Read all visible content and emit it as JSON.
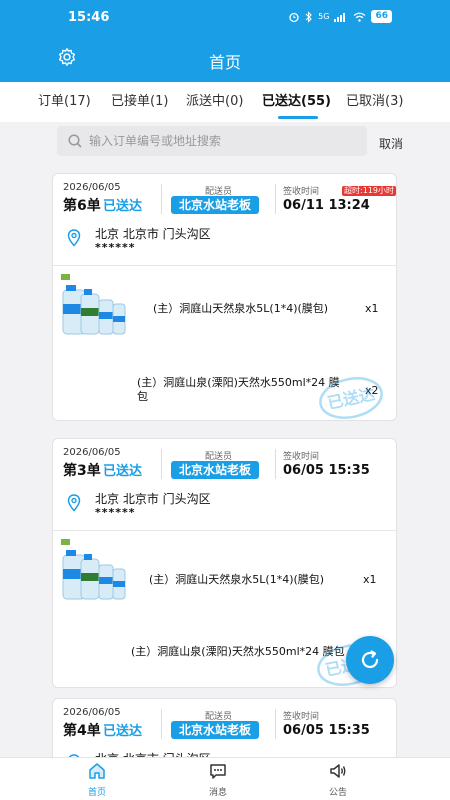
{
  "status_bar": {
    "time": "15:46",
    "battery": "66",
    "signal_text": "5G"
  },
  "header": {
    "title": "首页",
    "settings_icon": "gear-icon"
  },
  "tabs": [
    {
      "label": "订单(17)"
    },
    {
      "label": "已接单(1)"
    },
    {
      "label": "派送中(0)"
    },
    {
      "label": "已送达(55)",
      "active": true
    },
    {
      "label": "已取消(3)"
    }
  ],
  "search": {
    "placeholder": "输入订单编号或地址搜索",
    "value": "",
    "cancel_label": "取消"
  },
  "orders": [
    {
      "date": "2026/06/05",
      "number": "第6单",
      "status": "已送达",
      "courier_label": "配送员",
      "courier_name": "北京水站老板",
      "sign_label": "签收时间",
      "sign_time": "06/11 13:24",
      "overdue": "超时:119小时",
      "address_line1": "北京  北京市  门头沟区",
      "address_line2": "******",
      "items": [
        {
          "name": "(主）洞庭山天然泉水5L(1*4)(膜包)",
          "qty": "x1"
        },
        {
          "name": "(主）洞庭山泉(溧阳)天然水550ml*24 膜包",
          "qty": "x2"
        }
      ],
      "stamp": "已送达"
    },
    {
      "date": "2026/06/05",
      "number": "第3单",
      "status": "已送达",
      "courier_label": "配送员",
      "courier_name": "北京水站老板",
      "sign_label": "签收时间",
      "sign_time": "06/05 15:35",
      "address_line1": "北京  北京市  门头沟区",
      "address_line2": "******",
      "items": [
        {
          "name": "(主）洞庭山天然泉水5L(1*4)(膜包)",
          "qty": "x1"
        },
        {
          "name": "(主）洞庭山泉(溧阳)天然水550ml*24 膜包",
          "qty": ""
        }
      ],
      "stamp": "已送达"
    },
    {
      "date": "2026/06/05",
      "number": "第4单",
      "status": "已送达",
      "courier_label": "配送员",
      "courier_name": "北京水站老板",
      "sign_label": "签收时间",
      "sign_time": "06/05 15:35",
      "address_line1": "北京  北京市  门头沟区"
    }
  ],
  "bottom_nav": [
    {
      "label": "首页",
      "icon": "home-icon",
      "active": true
    },
    {
      "label": "消息",
      "icon": "message-icon"
    },
    {
      "label": "公告",
      "icon": "speaker-icon"
    }
  ],
  "colors": {
    "primary": "#1a9fe6",
    "overdue": "#e53935"
  }
}
